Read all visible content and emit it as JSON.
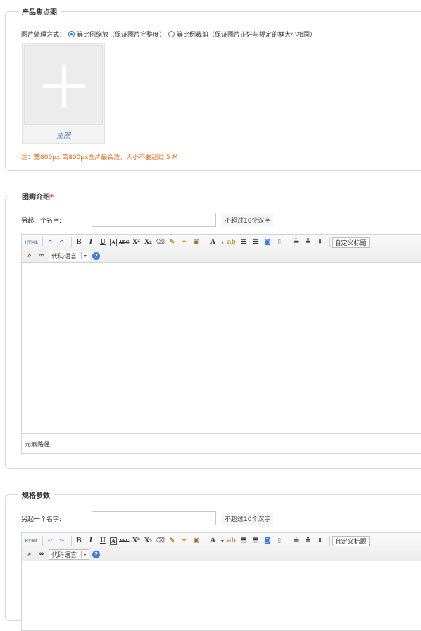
{
  "focus_section": {
    "legend": "产品焦点图",
    "processing_label": "图片处理方式：",
    "option_scale": "等比例缩放（保证图片完整度）",
    "option_crop": "等比例裁剪（保证图片正好与规定的框大小相同）",
    "upload_caption": "主图",
    "note": "注：宽800px 高800px图片最合适，大小不要超过 5 M"
  },
  "group_section": {
    "legend": "团购介绍",
    "required_mark": "*",
    "alias_label": "另起一个名字:",
    "alias_value": "",
    "alias_hint": "不超过10个汉字",
    "status_label": "元素路径:"
  },
  "spec_section": {
    "legend": "规格参数",
    "alias_label": "另起一个名字:",
    "alias_value": "",
    "alias_hint": "不超过10个汉字"
  },
  "editor_toolbar": {
    "html_label": "HTML",
    "bold": "B",
    "italic": "I",
    "underline": "U",
    "text_color": "A",
    "custom_heading": "自定义标题",
    "code_language": "代码语言",
    "help": "?"
  }
}
